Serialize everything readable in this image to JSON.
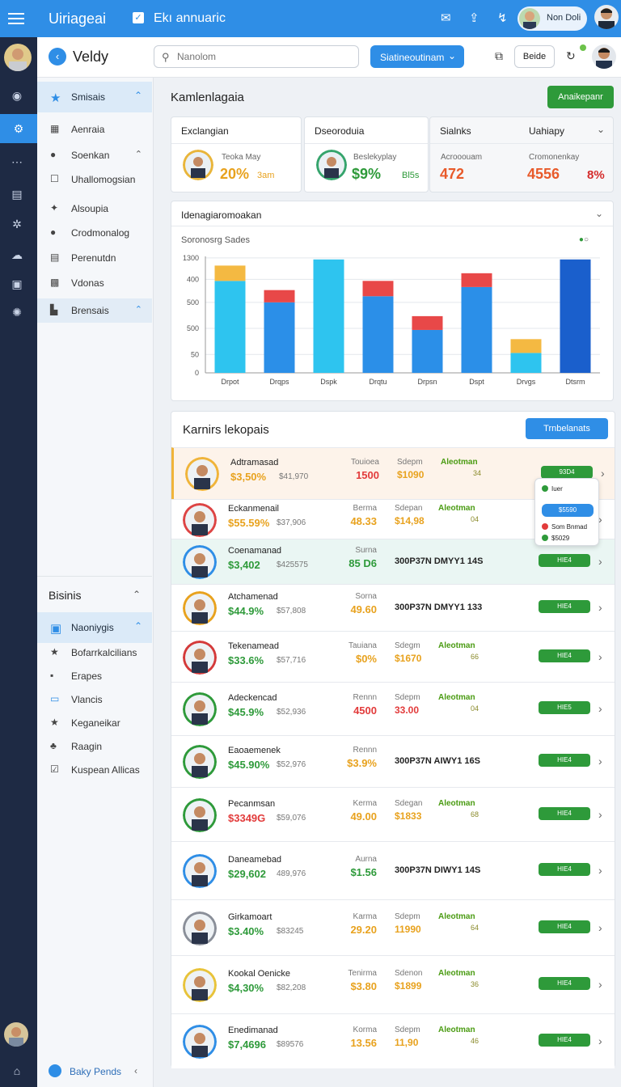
{
  "appbar": {
    "brand": "Uiriageai",
    "subtitle": "Ekı annuaric",
    "user_name": "Non Doli"
  },
  "header": {
    "title": "Veldy",
    "search_placeholder": "Nanolom",
    "dropdown_label": "Siatineoutinam",
    "button_label": "Beide"
  },
  "sidebar": {
    "section1": "Smisais",
    "items": [
      "Aenraia",
      "Soenkan",
      "Uhallomogsian",
      "Alsoupia",
      "Crodmonalog",
      "Perenutdn",
      "Vdonas"
    ],
    "active": "Brensais",
    "bottom_heading": "Bisinis",
    "section2": "Naoniygis",
    "items2": [
      "Bofarrkalcilians",
      "Erapes",
      "Vlancis",
      "Keganeikar",
      "Raagin",
      "Kuspean Allicas"
    ],
    "footer": "Baky Pends"
  },
  "page": {
    "title": "Kamlenlagaia",
    "action": "Anaikepanr"
  },
  "stats": [
    {
      "header": "Exclangian",
      "label": "Teoka May",
      "value": "20%",
      "value2": "3am",
      "color": "#e8a21e",
      "color2": "#e8a21e"
    },
    {
      "header": "Dseoroduia",
      "label": "Beslekyplay",
      "value": "$9%",
      "value2": "Bl5s",
      "color": "#2e9a3a",
      "color2": "#2e9a3a"
    },
    {
      "header": "Sialnks",
      "header2": "Uahiapy",
      "label": "Acrooouam",
      "label2": "Cromonenkay",
      "value": "472",
      "value2": "4556",
      "value3": "8%",
      "color": "#e85a2a",
      "color2": "#e85a2a"
    }
  ],
  "chart_section": {
    "title": "Idenagiaromoakan",
    "subtitle": "Soronosrg  Sades"
  },
  "chart_data": {
    "type": "bar",
    "categories": [
      "Drpot",
      "Drqps",
      "Dspk",
      "Drqtu",
      "Drpsn",
      "Dspt",
      "Drvgs",
      "Dtsrm"
    ],
    "yticks": [
      "0",
      "50",
      "500",
      "500",
      "400",
      "1300"
    ],
    "series": [
      {
        "name": "",
        "color": "#2aa8f0",
        "values": [
          3,
          2.3,
          3.7,
          2.5,
          1.4,
          2.8,
          0.65,
          3.7
        ]
      },
      {
        "name": "",
        "color": "#f4b942",
        "values": [
          0.5,
          0,
          0,
          0,
          0,
          0,
          0.45,
          0
        ]
      },
      {
        "name": "",
        "color": "#e84848",
        "values": [
          0,
          0.4,
          0,
          0.5,
          0.45,
          0.45,
          0,
          0
        ]
      }
    ],
    "bar_colors": [
      "#2ec4ef",
      "#2b8fe8",
      "#2ec4ef",
      "#2b8fe8",
      "#2b8fe8",
      "#2b8fe8",
      "#2ec4ef",
      "#1a5fcc"
    ],
    "ylim": [
      0,
      3.8
    ]
  },
  "list": {
    "title": "Karnirs lekopais",
    "button": "Trnbelanats",
    "rows": [
      {
        "name": "Adtramasad",
        "value": "$3,50%",
        "sub": "$41,970",
        "l1": "Touioea",
        "v1": "1500",
        "v1c": "#e23b3b",
        "l2": "Sdepm",
        "v2": "$1090",
        "v2c": "#e8a21e",
        "l3": "Aleotman",
        "n3": "34",
        "pill": "93D4",
        "bg": "#fdf3ea",
        "vc": "#e8a21e"
      },
      {
        "name": "Eckanmenail",
        "value": "$55.59%",
        "sub": "$37,906",
        "l1": "Berma",
        "v1": "48.33",
        "v1c": "#e8a21e",
        "l2": "Sdepan",
        "v2": "$14,98",
        "v2c": "#e8a21e",
        "l3": "Aleotman",
        "n3": "04",
        "pill": "",
        "bg": "#ffffff",
        "vc": "#e8a21e"
      },
      {
        "name": "Coenamanad",
        "value": "$3,402",
        "sub": "$425575",
        "l1": "Surna",
        "v1": "85 D6",
        "v1c": "#2e9a3a",
        "mono": "300P37N  DMYY1 14S",
        "pill": "HIE4",
        "bg": "#eaf6f3",
        "vc": "#2e9a3a"
      },
      {
        "name": "Atchamenad",
        "value": "$44.9%",
        "sub": "$57,808",
        "l1": "Sorna",
        "v1": "49.60",
        "v1c": "#e8a21e",
        "mono": "300P37N  DMYY1 133",
        "pill": "HIE4",
        "bg": "#ffffff",
        "vc": "#2e9a3a"
      },
      {
        "name": "Tekenamead",
        "value": "$33.6%",
        "sub": "$57,716",
        "l1": "Tauiana",
        "v1": "$0%",
        "v1c": "#e8a21e",
        "l2": "Sdegm",
        "v2": "$1670",
        "v2c": "#e8a21e",
        "l3": "Aleotman",
        "n3": "66",
        "pill": "HIE4",
        "bg": "#ffffff",
        "vc": "#2e9a3a"
      },
      {
        "name": "Adeckencad",
        "value": "$45.9%",
        "sub": "$52,936",
        "l1": "Rennn",
        "v1": "4500",
        "v1c": "#e23b3b",
        "l2": "Sdepm",
        "v2": "33.00",
        "v2c": "#e23b3b",
        "l3": "Aleotman",
        "n3": "04",
        "pill": "HIE5",
        "bg": "#ffffff",
        "vc": "#2e9a3a"
      },
      {
        "name": "Eaoaemenek",
        "value": "$45.90%",
        "sub": "$52,976",
        "l1": "Rennn",
        "v1": "$3.9%",
        "v1c": "#e8a21e",
        "mono": "300P37N  AIWY1 16S",
        "pill": "HIE4",
        "bg": "#ffffff",
        "vc": "#2e9a3a"
      },
      {
        "name": "Pecanmsan",
        "value": "$3349G",
        "sub": "$59,076",
        "l1": "Kerma",
        "v1": "49.00",
        "v1c": "#e8a21e",
        "l2": "Sdegan",
        "v2": "$1833",
        "v2c": "#e8a21e",
        "l3": "Aleotman",
        "n3": "68",
        "pill": "HIE4",
        "bg": "#ffffff",
        "vc": "#e23b3b"
      },
      {
        "name": "Daneamebad",
        "value": "$29,602",
        "sub": "489,976",
        "l1": "Aurna",
        "v1": "$1.56",
        "v1c": "#2e9a3a",
        "mono": "300P37N  DIWY1 14S",
        "pill": "HIE4",
        "bg": "#ffffff",
        "vc": "#2e9a3a"
      },
      {
        "name": "Girkamoart",
        "value": "$3.40%",
        "sub": "$83245",
        "l1": "Karma",
        "v1": "29.20",
        "v1c": "#e8a21e",
        "l2": "Sdepm",
        "v2": "11990",
        "v2c": "#e8a21e",
        "l3": "Aleotman",
        "n3": "64",
        "pill": "HIE4",
        "bg": "#ffffff",
        "vc": "#2e9a3a"
      },
      {
        "name": "Kookal Oenicke",
        "value": "$4,30%",
        "sub": "$82,208",
        "l1": "Tenirma",
        "v1": "$3.80",
        "v1c": "#e8a21e",
        "l2": "Sdenon",
        "v2": "$1899",
        "v2c": "#e8a21e",
        "l3": "Aleotman",
        "n3": "36",
        "pill": "HIE4",
        "bg": "#ffffff",
        "vc": "#2e9a3a"
      },
      {
        "name": "Enedimanad",
        "value": "$7,4696",
        "sub": "$89576",
        "l1": "Korma",
        "v1": "13.56",
        "v1c": "#e8a21e",
        "l2": "Sdepm",
        "v2": "11,90",
        "v2c": "#e8a21e",
        "l3": "Aleotman",
        "n3": "46",
        "pill": "HIE4",
        "bg": "#ffffff",
        "vc": "#2e9a3a"
      }
    ],
    "popup": {
      "line1": "Iuer",
      "button": "$5590",
      "line2": "Som Bnmad",
      "line3": "$5029"
    }
  }
}
